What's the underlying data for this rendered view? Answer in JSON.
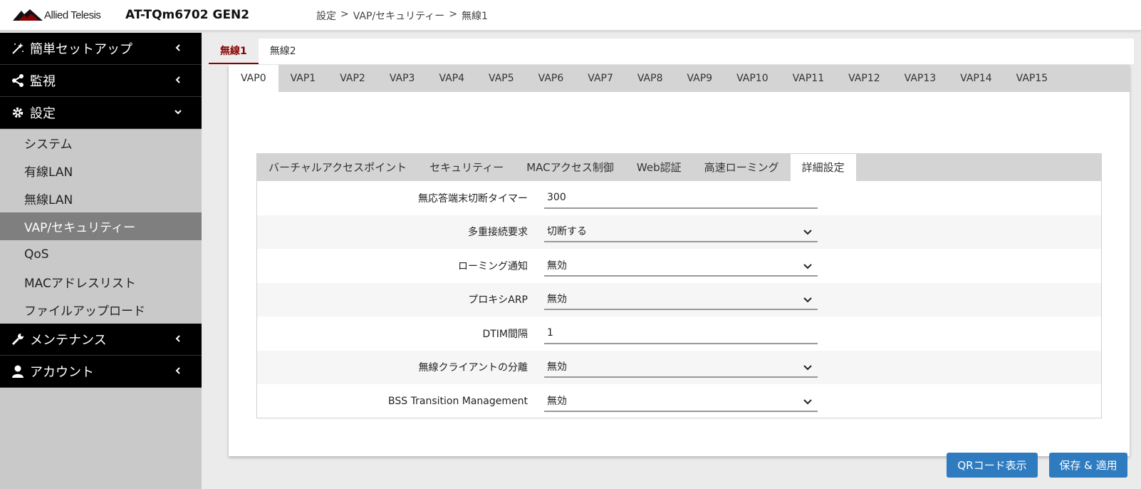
{
  "header": {
    "brand": "Allied Telesis",
    "device": "AT-TQm6702 GEN2",
    "breadcrumb": [
      "設定",
      ">",
      "VAP/セキュリティー",
      ">",
      "無線1"
    ]
  },
  "sidebar": {
    "sections": [
      {
        "label": "簡単セットアップ",
        "icon": "magic-wand-icon"
      },
      {
        "label": "監視",
        "icon": "share-icon"
      },
      {
        "label": "設定",
        "icon": "gear-icon"
      }
    ],
    "items": [
      "システム",
      "有線LAN",
      "無線LAN",
      "VAP/セキュリティー",
      "QoS",
      "MACアドレスリスト",
      "ファイルアップロード"
    ],
    "bottom_sections": [
      {
        "label": "メンテナンス",
        "icon": "wrench-icon"
      },
      {
        "label": "アカウント",
        "icon": "user-icon"
      }
    ]
  },
  "radio_tabs": [
    "無線1",
    "無線2"
  ],
  "vap_tabs": [
    "VAP0",
    "VAP1",
    "VAP2",
    "VAP3",
    "VAP4",
    "VAP5",
    "VAP6",
    "VAP7",
    "VAP8",
    "VAP9",
    "VAP10",
    "VAP11",
    "VAP12",
    "VAP13",
    "VAP14",
    "VAP15"
  ],
  "sub_tabs": [
    "バーチャルアクセスポイント",
    "セキュリティー",
    "MACアクセス制御",
    "Web認証",
    "高速ローミング",
    "詳細設定"
  ],
  "form": [
    {
      "label": "無応答端末切断タイマー",
      "value": "300",
      "type": "input"
    },
    {
      "label": "多重接続要求",
      "value": "切断する",
      "type": "select"
    },
    {
      "label": "ローミング通知",
      "value": "無効",
      "type": "select"
    },
    {
      "label": "プロキシARP",
      "value": "無効",
      "type": "select"
    },
    {
      "label": "DTIM間隔",
      "value": "1",
      "type": "input"
    },
    {
      "label": "無線クライアントの分離",
      "value": "無効",
      "type": "select"
    },
    {
      "label": "BSS Transition Management",
      "value": "無効",
      "type": "select"
    }
  ],
  "buttons": {
    "qr": "QRコード表示",
    "save": "保存 & 適用"
  },
  "colors": {
    "accent": "#8b0000",
    "button": "#2f7bc0",
    "sidebar_head": "#000000",
    "sidebar_active": "#7f7f7f"
  }
}
